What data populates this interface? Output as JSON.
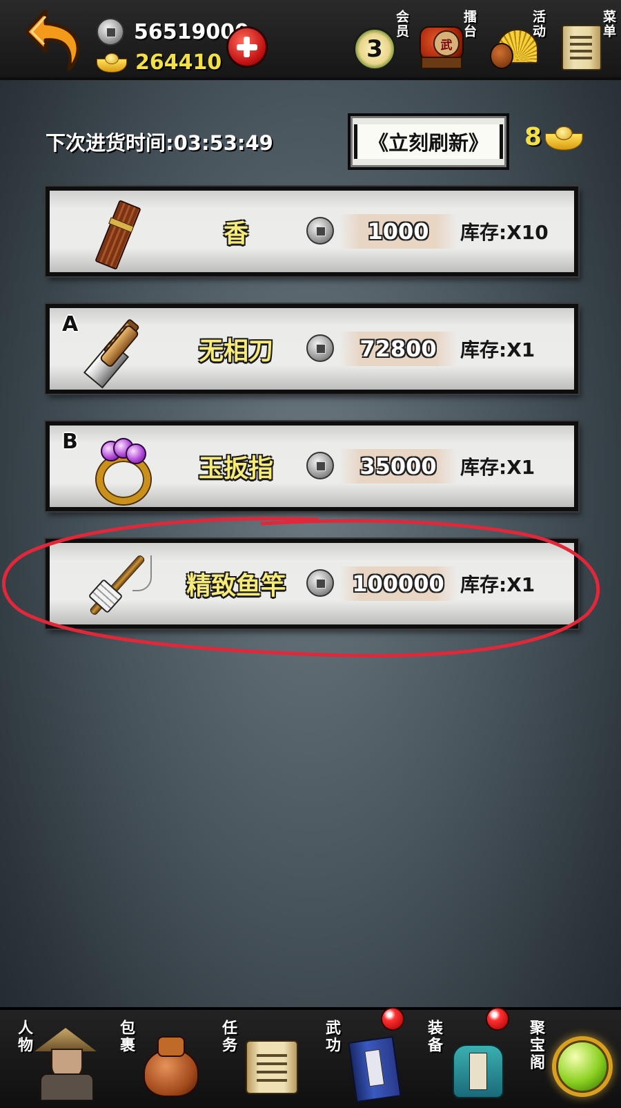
{
  "header": {
    "silver_amount": "56519000",
    "gold_amount": "264410",
    "vip_level": "3",
    "icons": [
      {
        "label": "会员",
        "icon": "vip-badge-icon"
      },
      {
        "label": "擂台",
        "icon": "war-drum-icon"
      },
      {
        "label": "活动",
        "icon": "fan-gourd-icon"
      },
      {
        "label": "菜单",
        "icon": "scroll-menu-icon"
      }
    ],
    "drum_glyph": "武"
  },
  "shop": {
    "timer_label": "下次进货时间:03:53:49",
    "refresh_label": "《立刻刷新》",
    "refresh_cost": "8",
    "items": [
      {
        "grade": "",
        "name": "香",
        "price": "1000",
        "stock": "库存:X10",
        "icon": "incense-icon"
      },
      {
        "grade": "A",
        "name": "无相刀",
        "price": "72800",
        "stock": "库存:X1",
        "icon": "sword-icon"
      },
      {
        "grade": "B",
        "name": "玉扳指",
        "price": "35000",
        "stock": "库存:X1",
        "icon": "ring-icon"
      },
      {
        "grade": "",
        "name": "精致鱼竿",
        "price": "100000",
        "stock": "库存:X1",
        "icon": "fishing-rod-icon"
      }
    ]
  },
  "bottom_nav": [
    {
      "label": "人物",
      "icon": "character-icon",
      "alert": false
    },
    {
      "label": "包裹",
      "icon": "bag-icon",
      "alert": false
    },
    {
      "label": "任务",
      "icon": "quest-scroll-icon",
      "alert": false
    },
    {
      "label": "武功",
      "icon": "martial-book-icon",
      "alert": true
    },
    {
      "label": "装备",
      "icon": "equipment-icon",
      "alert": true
    },
    {
      "label": "聚宝阁",
      "icon": "treasure-orb-icon",
      "alert": false
    }
  ],
  "colors": {
    "annotation": "#e0283a",
    "gold_text": "#f3e046",
    "item_name": "#f6ea7a"
  }
}
